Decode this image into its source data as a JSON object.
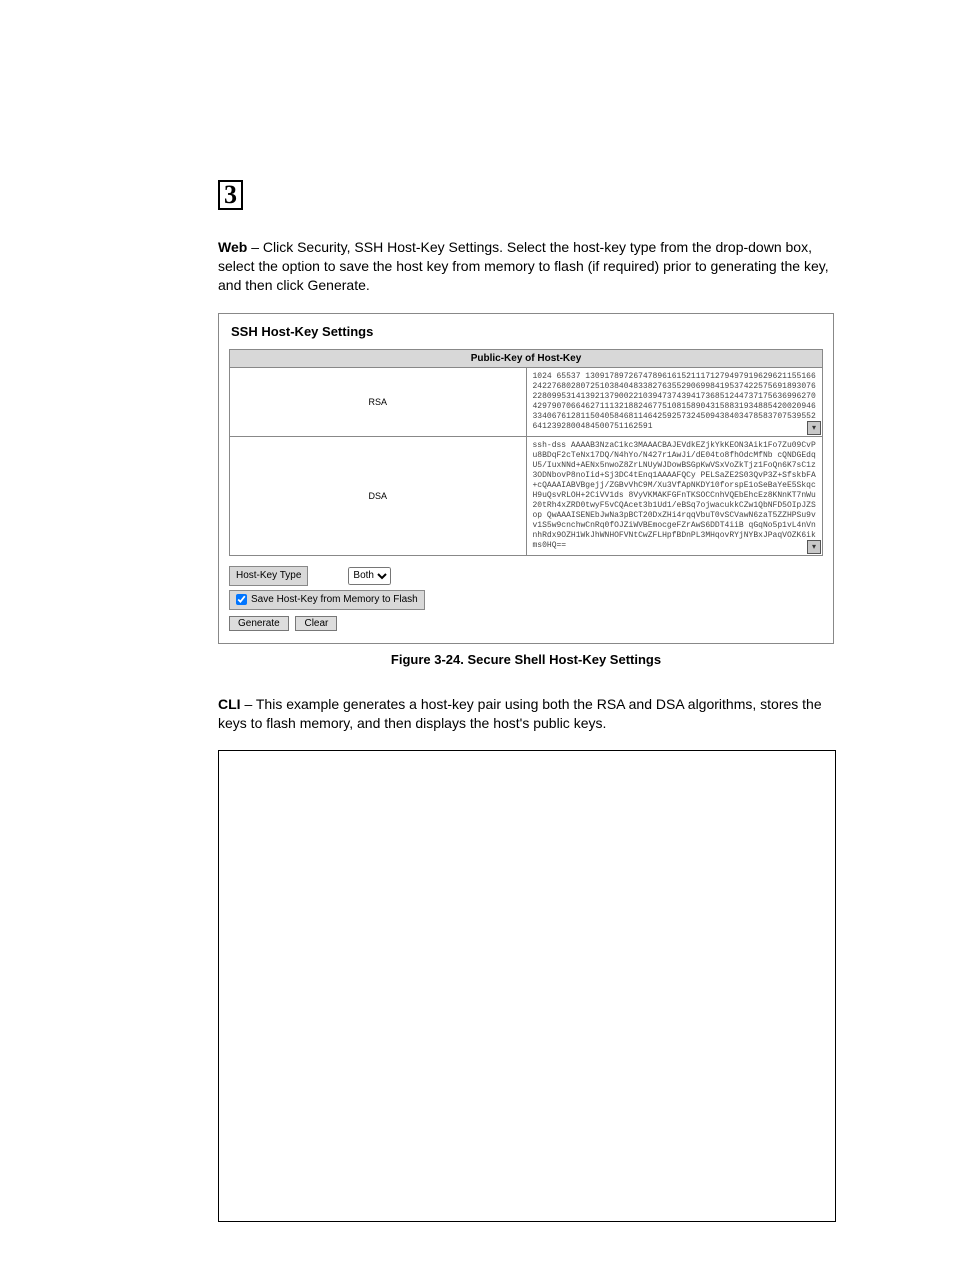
{
  "chapter_mark": "3",
  "intro": {
    "lead": "Web",
    "rest": " – Click Security, SSH Host-Key Settings. Select the host-key type from the drop-down box, select the option to save the host key from memory to flash (if required) prior to generating the key, and then click Generate."
  },
  "panel": {
    "title": "SSH Host-Key Settings",
    "header": "Public-Key of Host-Key",
    "rsa_label": "RSA",
    "rsa_key": "1024 65537 130917897267478961615211171279497919629621155166242276802807251038404833827635529069984195374225756918930762280995314139213790022103947374394173685124473717563699627042979070664627111321882467751081589043158831934885420020946334067612811504058468114642592573245094384034785837075395526412392800484500751162591",
    "dsa_label": "DSA",
    "dsa_key": "ssh-dss AAAAB3NzaC1kc3MAAACBAJEVdkEZjkYkKEON3Aik1Fo7Zu09CvPu8BDqF2cTeNx17DQ/N4hYo/N427r1AwJi/dE04to8fhOdcMfNb cQNDGEdqU5/IuxNNd+AENx5nwoZ8ZrLNUyWJDowBSGpKwVSxVoZkTjz1FoQn6K7sC1z3ODNbovP8noIid+Sj3DC4tEnq1AAAAFQCy PELSaZE2S03QvP3Z+SfskbFA+cQAAAIABVBgejj/ZGBvVhC9M/Xu3VfApNKDY10forspE1oSeBaYeE5SkqcH9uQsvRLOH+2CiVV1ds 8VyVKMAKFGFnTKSOCCnhVQEbEhcEz8KNnKT7nWu20tRh4xZRD0twyF5vCQAcet3b1Ud1/eBSq7ojwacukkCZw1QbNFD5OIpJZSop QwAAAISENEbJwNa3pBCT20DxZHi4rqqVbuT0vSCVawN6zaT5ZZHPSu9vv1S5w9cnchwCnRq0fOJZiWVBEmocgeFZrAwS6DDT4iiB qGqNo5p1vL4nVnnhRdx9OZH1WkJhWNHOFVNtCwZFLHpfBDnPL3MHqovRYjNYBxJPaqVOZK6ikms0HQ==",
    "hostkey_label": "Host-Key Type",
    "hostkey_selected": "Both",
    "save_flash_label": "Save Host-Key from Memory to Flash",
    "generate_label": "Generate",
    "clear_label": "Clear"
  },
  "figure_caption": "Figure 3-24.  Secure Shell Host-Key Settings",
  "cli": {
    "lead": "CLI",
    "rest": " – This example generates a host-key pair using both the RSA and DSA algorithms, stores the keys to flash memory, and then displays the host's public keys."
  }
}
